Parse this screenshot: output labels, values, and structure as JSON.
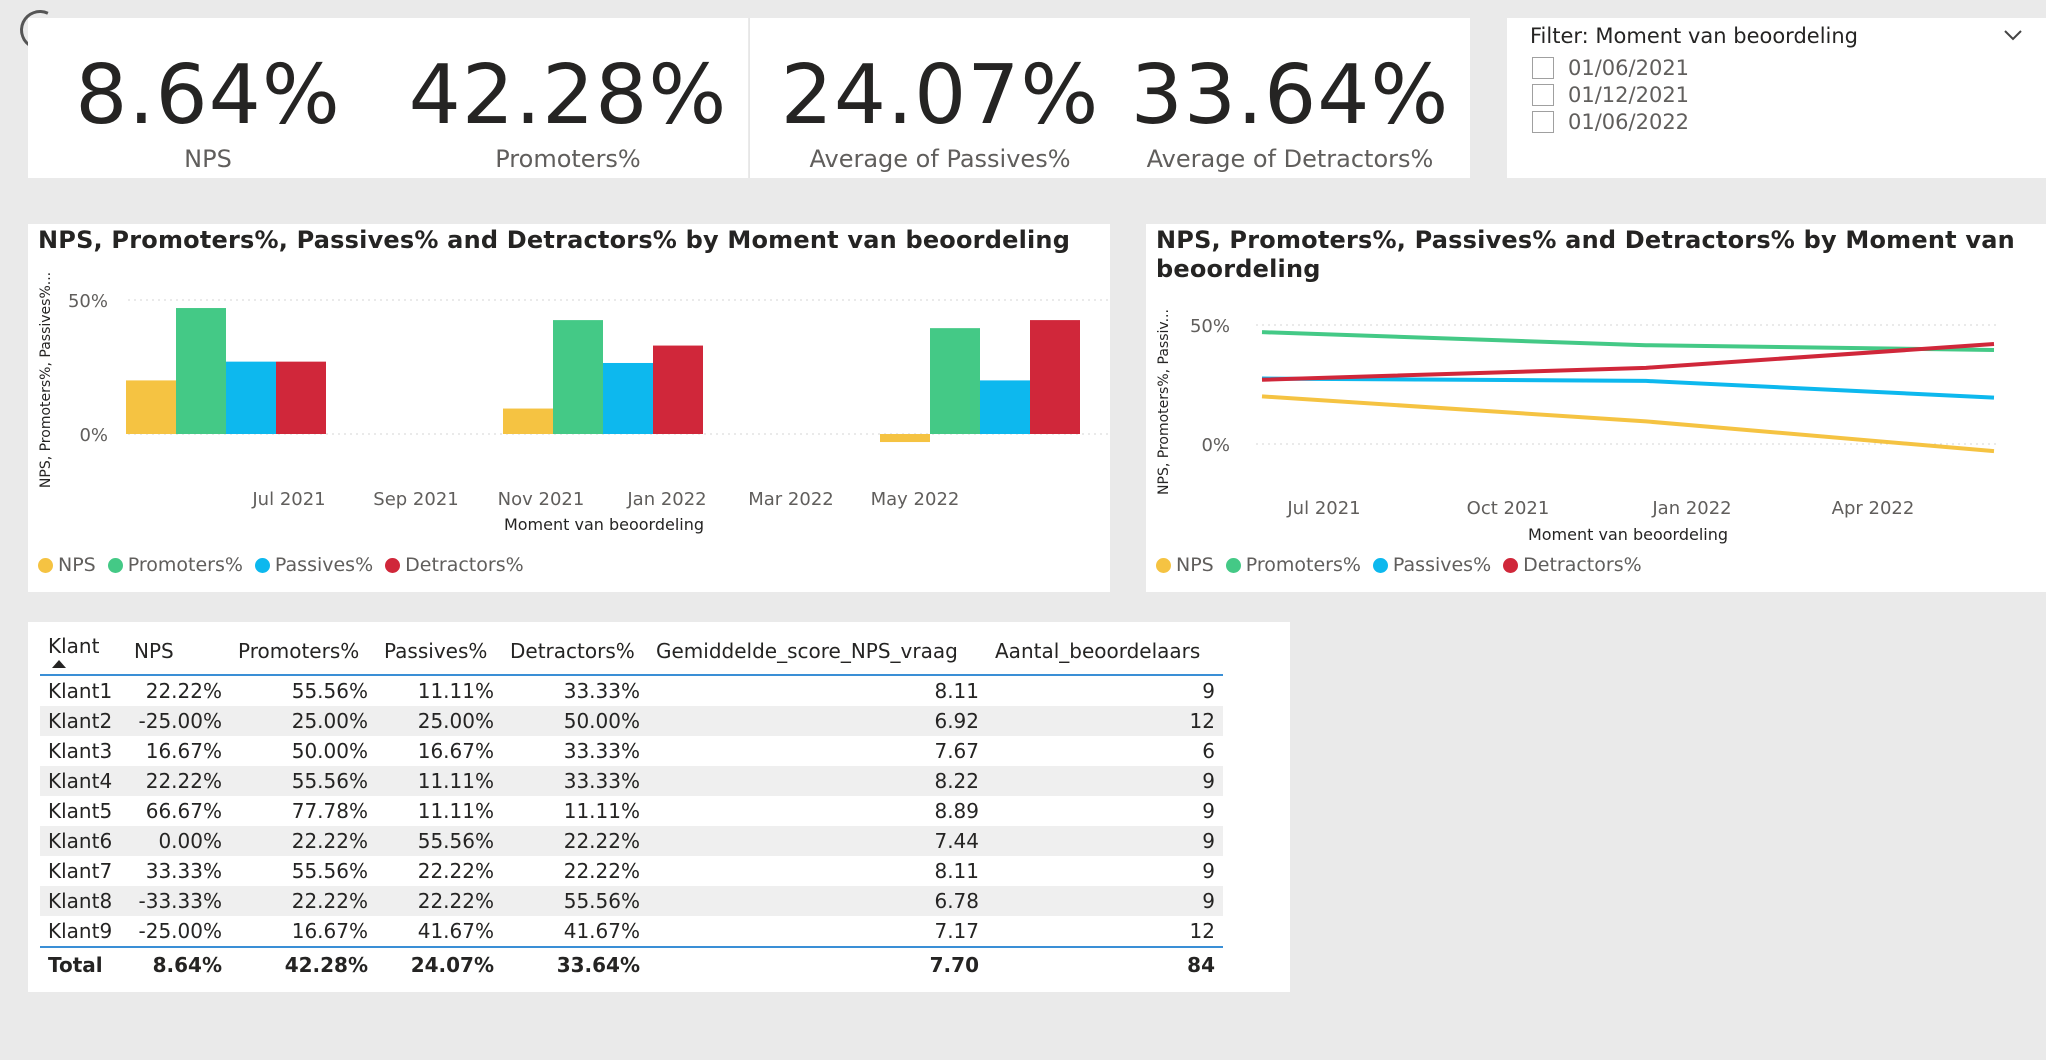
{
  "kpis": [
    {
      "value": "8.64%",
      "label": "NPS"
    },
    {
      "value": "42.28%",
      "label": "Promoters%"
    },
    {
      "value": "24.07%",
      "label": "Average of Passives%"
    },
    {
      "value": "33.64%",
      "label": "Average of Detractors%"
    }
  ],
  "filter": {
    "title": "Filter: Moment van beoordeling",
    "options": [
      "01/06/2021",
      "01/12/2021",
      "01/06/2022"
    ]
  },
  "colors": {
    "nps": "#F5C342",
    "promoters": "#44C986",
    "passives": "#0DB8EE",
    "detractors": "#D0273A"
  },
  "legend": [
    "NPS",
    "Promoters%",
    "Passives%",
    "Detractors%"
  ],
  "chart_data": [
    {
      "type": "bar",
      "title": "NPS, Promoters%, Passives% and Detractors% by Moment van beoordeling",
      "xlabel": "Moment van beoordeling",
      "ylabel": "NPS, Promoters%, Passives%...",
      "x_ticks": [
        "Jul 2021",
        "Sep 2021",
        "Nov 2021",
        "Jan 2022",
        "Mar 2022",
        "May 2022"
      ],
      "y_ticks": [
        "0%",
        "50%"
      ],
      "categories": [
        "01/06/2021",
        "01/12/2021",
        "01/06/2022"
      ],
      "series": [
        {
          "name": "NPS",
          "values": [
            20,
            9.5,
            -3
          ]
        },
        {
          "name": "Promoters%",
          "values": [
            47,
            42.5,
            39.5
          ]
        },
        {
          "name": "Passives%",
          "values": [
            27,
            26.5,
            20
          ]
        },
        {
          "name": "Detractors%",
          "values": [
            27,
            33,
            42.5
          ]
        }
      ],
      "ylim": [
        -20,
        55
      ]
    },
    {
      "type": "line",
      "title": "NPS, Promoters%, Passives% and Detractors% by Moment van beoordeling",
      "xlabel": "Moment van beoordeling",
      "ylabel": "NPS, Promoters%, Passiv...",
      "x_ticks": [
        "Jul 2021",
        "Oct 2021",
        "Jan 2022",
        "Apr 2022"
      ],
      "y_ticks": [
        "0%",
        "50%"
      ],
      "categories": [
        "01/06/2021",
        "01/12/2021",
        "01/06/2022"
      ],
      "series": [
        {
          "name": "NPS",
          "values": [
            20,
            9.5,
            -3
          ]
        },
        {
          "name": "Promoters%",
          "values": [
            47,
            41.5,
            39.5
          ]
        },
        {
          "name": "Passives%",
          "values": [
            27.5,
            26.5,
            19.5
          ]
        },
        {
          "name": "Detractors%",
          "values": [
            27,
            32,
            42
          ]
        }
      ],
      "ylim": [
        -20,
        55
      ]
    }
  ],
  "table": {
    "columns": [
      "Klant",
      "NPS",
      "Promoters%",
      "Passives%",
      "Detractors%",
      "Gemiddelde_score_NPS_vraag",
      "Aantal_beoordelaars"
    ],
    "rows": [
      [
        "Klant1",
        "22.22%",
        "55.56%",
        "11.11%",
        "33.33%",
        "8.11",
        "9"
      ],
      [
        "Klant2",
        "-25.00%",
        "25.00%",
        "25.00%",
        "50.00%",
        "6.92",
        "12"
      ],
      [
        "Klant3",
        "16.67%",
        "50.00%",
        "16.67%",
        "33.33%",
        "7.67",
        "6"
      ],
      [
        "Klant4",
        "22.22%",
        "55.56%",
        "11.11%",
        "33.33%",
        "8.22",
        "9"
      ],
      [
        "Klant5",
        "66.67%",
        "77.78%",
        "11.11%",
        "11.11%",
        "8.89",
        "9"
      ],
      [
        "Klant6",
        "0.00%",
        "22.22%",
        "55.56%",
        "22.22%",
        "7.44",
        "9"
      ],
      [
        "Klant7",
        "33.33%",
        "55.56%",
        "22.22%",
        "22.22%",
        "8.11",
        "9"
      ],
      [
        "Klant8",
        "-33.33%",
        "22.22%",
        "22.22%",
        "55.56%",
        "6.78",
        "9"
      ],
      [
        "Klant9",
        "-25.00%",
        "16.67%",
        "41.67%",
        "41.67%",
        "7.17",
        "12"
      ]
    ],
    "total": [
      "Total",
      "8.64%",
      "42.28%",
      "24.07%",
      "33.64%",
      "7.70",
      "84"
    ]
  }
}
